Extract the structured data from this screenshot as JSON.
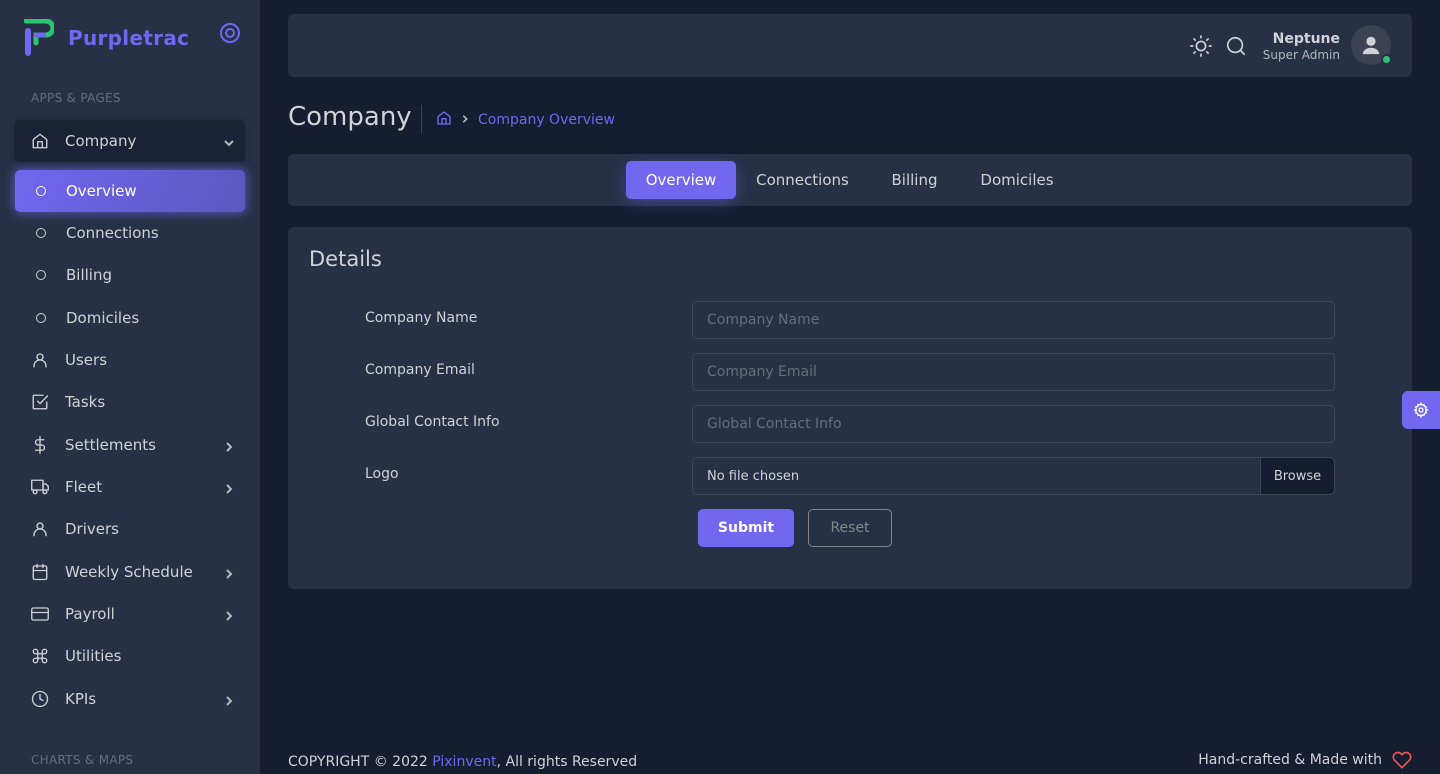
{
  "brand": {
    "name": "Purpletrac",
    "accent": "#7367f0"
  },
  "sidebar": {
    "section_apps": "APPS & PAGES",
    "section_charts": "CHARTS & MAPS",
    "company": {
      "label": "Company",
      "icon": "home-icon"
    },
    "sub_items": [
      {
        "label": "Overview",
        "active": true
      },
      {
        "label": "Connections"
      },
      {
        "label": "Billing"
      },
      {
        "label": "Domiciles"
      }
    ],
    "items": [
      {
        "label": "Users",
        "icon": "user-icon"
      },
      {
        "label": "Tasks",
        "icon": "check-square-icon"
      },
      {
        "label": "Settlements",
        "icon": "dollar-icon",
        "has_children": true
      },
      {
        "label": "Fleet",
        "icon": "truck-icon",
        "has_children": true
      },
      {
        "label": "Drivers",
        "icon": "user-icon"
      },
      {
        "label": "Weekly Schedule",
        "icon": "calendar-icon",
        "has_children": true
      },
      {
        "label": "Payroll",
        "icon": "credit-card-icon",
        "has_children": true
      },
      {
        "label": "Utilities",
        "icon": "command-icon"
      },
      {
        "label": "KPIs",
        "icon": "clock-icon",
        "has_children": true
      }
    ]
  },
  "navbar": {
    "user_name": "Neptune",
    "user_role": "Super Admin",
    "status_color": "#28c76f"
  },
  "page": {
    "title": "Company",
    "breadcrumb": "Company Overview"
  },
  "tabs": [
    {
      "label": "Overview",
      "active": true
    },
    {
      "label": "Connections"
    },
    {
      "label": "Billing"
    },
    {
      "label": "Domiciles"
    }
  ],
  "form": {
    "title": "Details",
    "company_name_label": "Company Name",
    "company_name_placeholder": "Company Name",
    "company_email_label": "Company Email",
    "company_email_placeholder": "Company Email",
    "contact_label": "Global Contact Info",
    "contact_placeholder": "Global Contact Info",
    "logo_label": "Logo",
    "file_text": "No file chosen",
    "browse_label": "Browse",
    "submit_label": "Submit",
    "reset_label": "Reset"
  },
  "footer": {
    "copyright_prefix": "COPYRIGHT © 2022",
    "company_link": "Pixinvent",
    "copyright_suffix": ", All rights Reserved",
    "made_with": "Hand-crafted & Made with"
  }
}
